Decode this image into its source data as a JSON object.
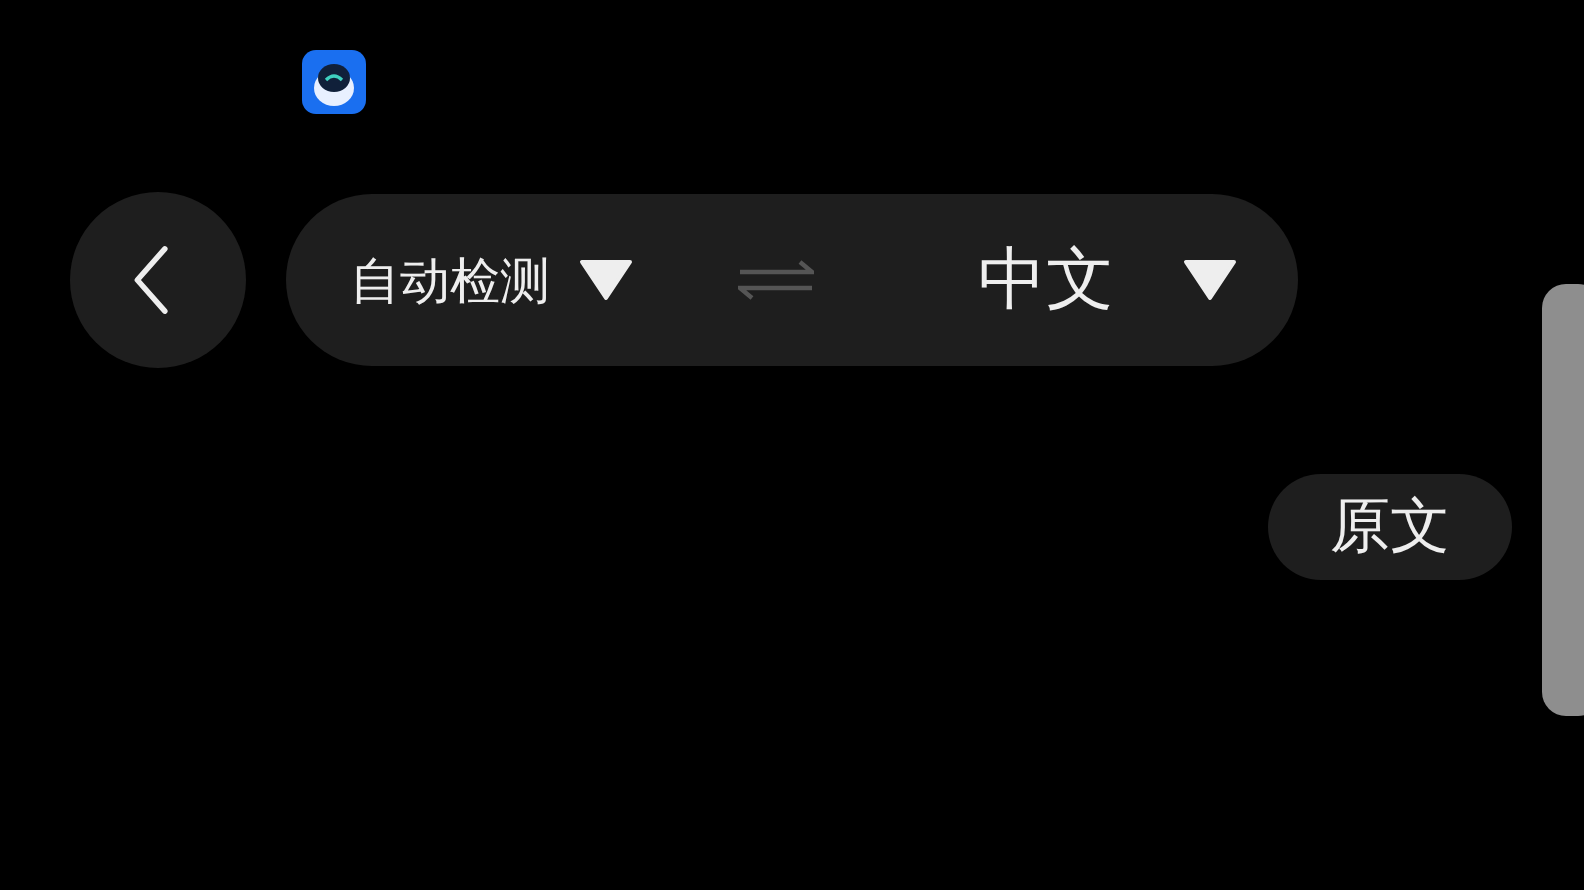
{
  "language_bar": {
    "source_language": "自动检测",
    "target_language": "中文",
    "swap_disabled": true
  },
  "original_text_button": {
    "label": "原文"
  }
}
